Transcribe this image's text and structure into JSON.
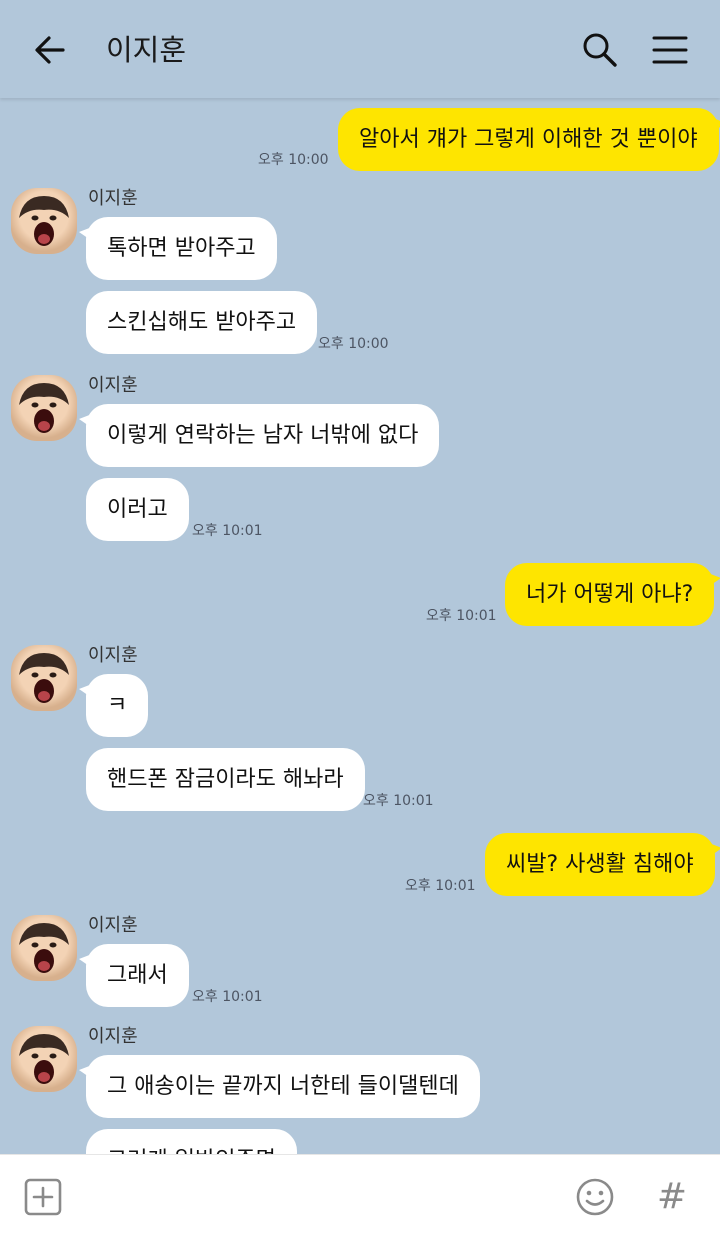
{
  "header": {
    "title": "이지훈",
    "back_icon": "back-arrow-icon",
    "search_icon": "search-icon",
    "menu_icon": "menu-icon"
  },
  "colors": {
    "background": "#b2c7da",
    "my_bubble": "#fee500",
    "friend_bubble": "#ffffff"
  },
  "messages": [
    {
      "sender": "me",
      "text": "알아서 걔가 그렇게 이해한 것 뿐이야",
      "time": "오후 10:00"
    },
    {
      "sender": "friend",
      "name": "이지훈",
      "text": "톡하면 받아주고"
    },
    {
      "sender": "friend",
      "text": "스킨십해도 받아주고",
      "time": "오후 10:00"
    },
    {
      "sender": "friend",
      "name": "이지훈",
      "text": "이렇게 연락하는 남자 너밖에 없다"
    },
    {
      "sender": "friend",
      "text": "이러고",
      "time": "오후 10:01"
    },
    {
      "sender": "me",
      "text": "너가 어떻게 아냐?",
      "time": "오후 10:01"
    },
    {
      "sender": "friend",
      "name": "이지훈",
      "text": "ㅋ"
    },
    {
      "sender": "friend",
      "text": "핸드폰 잠금이라도 해놔라",
      "time": "오후 10:01"
    },
    {
      "sender": "me",
      "text": "씨발? 사생활 침해야",
      "time": "오후 10:01"
    },
    {
      "sender": "friend",
      "name": "이지훈",
      "text": "그래서",
      "time": "오후 10:01"
    },
    {
      "sender": "friend",
      "name": "이지훈",
      "text": "그 애송이는 끝까지 너한테 들이댈텐데"
    },
    {
      "sender": "friend",
      "text": "그러게 일반인주면"
    }
  ],
  "bottom_bar": {
    "add_icon": "plus-square-icon",
    "emoji_icon": "smiley-icon",
    "hash_label": "#"
  }
}
